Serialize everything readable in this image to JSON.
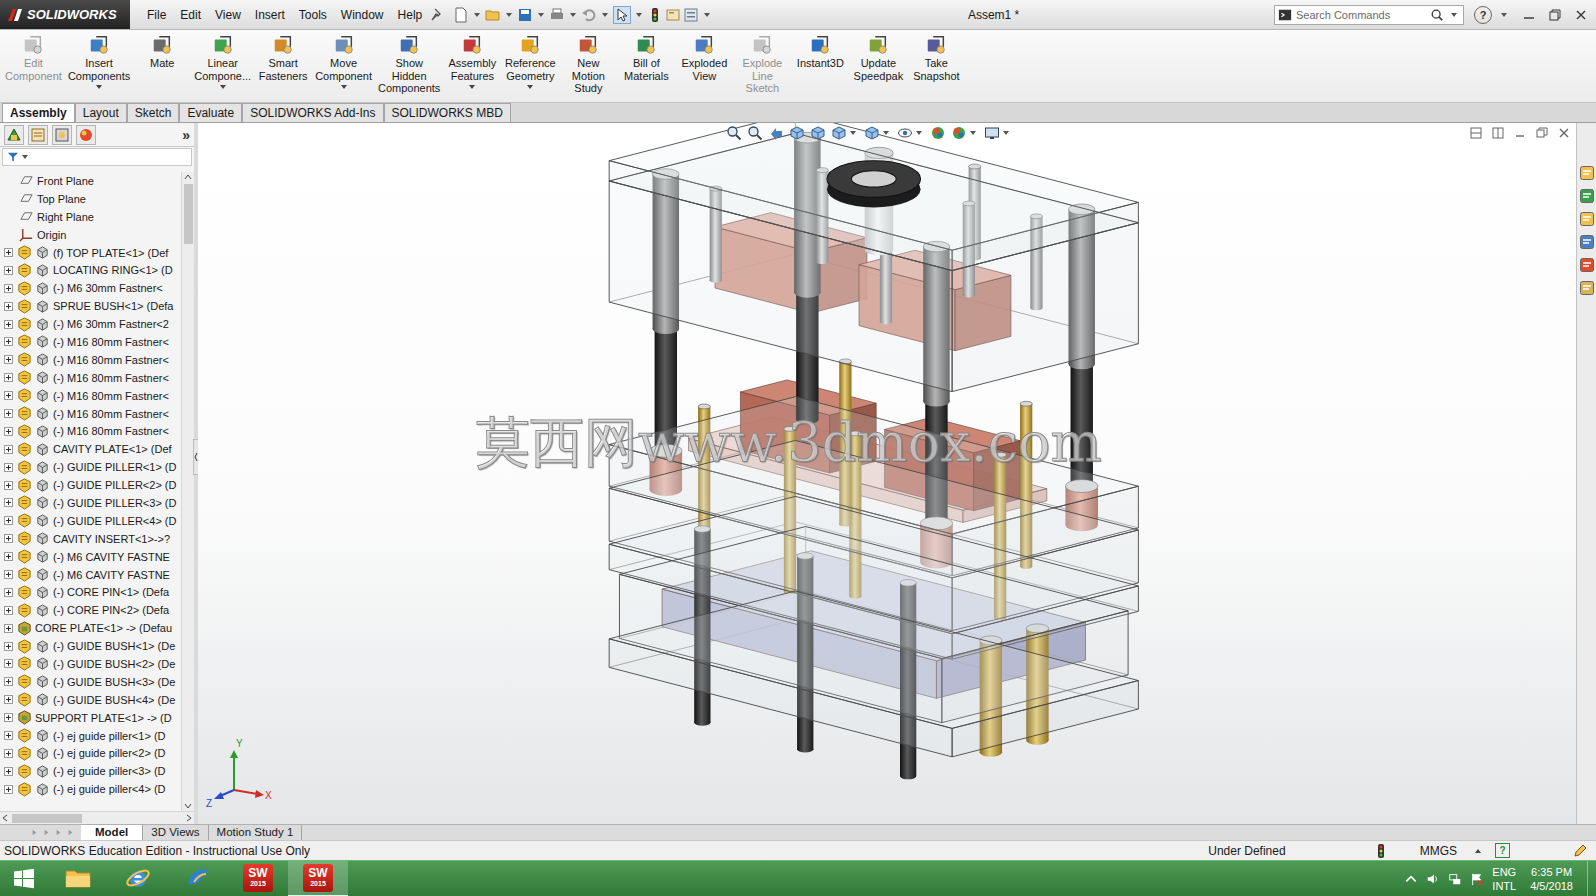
{
  "app": {
    "logo": "SOLIDWORKS",
    "title": "Assem1 *",
    "help": "?"
  },
  "menu": [
    "File",
    "Edit",
    "View",
    "Insert",
    "Tools",
    "Window",
    "Help"
  ],
  "search": {
    "placeholder": "Search Commands"
  },
  "ribbon": [
    {
      "lines": [
        "Edit",
        "Component"
      ],
      "dropdown": false,
      "disabled": true
    },
    {
      "lines": [
        "Insert",
        "Components"
      ],
      "dropdown": true,
      "disabled": false
    },
    {
      "lines": [
        "Mate"
      ],
      "dropdown": false,
      "disabled": false
    },
    {
      "lines": [
        "Linear",
        "Compone..."
      ],
      "dropdown": true,
      "disabled": false
    },
    {
      "lines": [
        "Smart",
        "Fasteners"
      ],
      "dropdown": false,
      "disabled": false
    },
    {
      "lines": [
        "Move",
        "Component"
      ],
      "dropdown": true,
      "disabled": false
    },
    {
      "lines": [
        "Show",
        "Hidden",
        "Components"
      ],
      "dropdown": false,
      "disabled": false
    },
    {
      "lines": [
        "Assembly",
        "Features"
      ],
      "dropdown": true,
      "disabled": false
    },
    {
      "lines": [
        "Reference",
        "Geometry"
      ],
      "dropdown": true,
      "disabled": false
    },
    {
      "lines": [
        "New",
        "Motion",
        "Study"
      ],
      "dropdown": false,
      "disabled": false
    },
    {
      "lines": [
        "Bill of",
        "Materials"
      ],
      "dropdown": false,
      "disabled": false
    },
    {
      "lines": [
        "Exploded",
        "View"
      ],
      "dropdown": false,
      "disabled": false
    },
    {
      "lines": [
        "Explode",
        "Line",
        "Sketch"
      ],
      "dropdown": false,
      "disabled": true
    },
    {
      "lines": [
        "Instant3D"
      ],
      "dropdown": false,
      "disabled": false
    },
    {
      "lines": [
        "Update",
        "Speedpak"
      ],
      "dropdown": false,
      "disabled": false
    },
    {
      "lines": [
        "Take",
        "Snapshot"
      ],
      "dropdown": false,
      "disabled": false
    }
  ],
  "tabs": [
    {
      "label": "Assembly",
      "selected": true
    },
    {
      "label": "Layout",
      "selected": false
    },
    {
      "label": "Sketch",
      "selected": false
    },
    {
      "label": "Evaluate",
      "selected": false
    },
    {
      "label": "SOLIDWORKS Add-Ins",
      "selected": false
    },
    {
      "label": "SOLIDWORKS MBD",
      "selected": false
    }
  ],
  "feature_manager": {
    "collapse": "»"
  },
  "tree": [
    {
      "label": "Front Plane",
      "kind": "plane",
      "expanded": false
    },
    {
      "label": "Top Plane",
      "kind": "plane",
      "expanded": false
    },
    {
      "label": "Right Plane",
      "kind": "plane",
      "expanded": false
    },
    {
      "label": "Origin",
      "kind": "origin",
      "expanded": false
    },
    {
      "label": "(f) TOP PLATE<1> (Def",
      "kind": "part",
      "expanded": false
    },
    {
      "label": "LOCATING RING<1> (D",
      "kind": "part",
      "expanded": false
    },
    {
      "label": "(-) M6 30mm Fastner<",
      "kind": "part",
      "expanded": false
    },
    {
      "label": "SPRUE BUSH<1> (Defa",
      "kind": "part",
      "expanded": false
    },
    {
      "label": "(-) M6 30mm Fastner<2",
      "kind": "part",
      "expanded": false
    },
    {
      "label": "(-) M16 80mm Fastner<",
      "kind": "part",
      "expanded": false
    },
    {
      "label": "(-) M16 80mm Fastner<",
      "kind": "part",
      "expanded": false
    },
    {
      "label": "(-) M16 80mm Fastner<",
      "kind": "part",
      "expanded": false
    },
    {
      "label": "(-) M16 80mm Fastner<",
      "kind": "part",
      "expanded": false
    },
    {
      "label": "(-) M16 80mm Fastner<",
      "kind": "part",
      "expanded": false
    },
    {
      "label": "(-) M16 80mm Fastner<",
      "kind": "part",
      "expanded": false
    },
    {
      "label": "CAVITY PLATE<1> (Def",
      "kind": "part",
      "expanded": false
    },
    {
      "label": "(-) GUIDE PILLER<1> (D",
      "kind": "part",
      "expanded": false
    },
    {
      "label": "(-) GUIDE PILLER<2> (D",
      "kind": "part",
      "expanded": false
    },
    {
      "label": "(-) GUIDE PILLER<3> (D",
      "kind": "part",
      "expanded": false
    },
    {
      "label": "(-) GUIDE PILLER<4> (D",
      "kind": "part",
      "expanded": false
    },
    {
      "label": "CAVITY INSERT<1>->?",
      "kind": "part",
      "expanded": false
    },
    {
      "label": "(-) M6 CAVITY FASTNE",
      "kind": "part",
      "expanded": false
    },
    {
      "label": "(-) M6 CAVITY FASTNE",
      "kind": "part",
      "expanded": false
    },
    {
      "label": "(-) CORE PIN<1> (Defa",
      "kind": "part",
      "expanded": false
    },
    {
      "label": "(-) CORE PIN<2> (Defa",
      "kind": "part",
      "expanded": false
    },
    {
      "label": "CORE PLATE<1> -> (Defau",
      "kind": "assembly",
      "expanded": false
    },
    {
      "label": "(-) GUIDE BUSH<1> (De",
      "kind": "part",
      "expanded": false
    },
    {
      "label": "(-) GUIDE BUSH<2> (De",
      "kind": "part",
      "expanded": false
    },
    {
      "label": "(-) GUIDE BUSH<3> (De",
      "kind": "part",
      "expanded": false
    },
    {
      "label": "(-) GUIDE BUSH<4> (De",
      "kind": "part",
      "expanded": false
    },
    {
      "label": "SUPPORT PLATE<1> -> (D",
      "kind": "assembly",
      "expanded": false
    },
    {
      "label": "(-) ej guide piller<1> (D",
      "kind": "part",
      "expanded": false
    },
    {
      "label": "(-) ej guide piller<2> (D",
      "kind": "part",
      "expanded": false
    },
    {
      "label": "(-) ej guide piller<3> (D",
      "kind": "part",
      "expanded": false
    },
    {
      "label": "(-) ej guide piller<4> (D",
      "kind": "part",
      "expanded": false
    }
  ],
  "viewport": {
    "watermark": "莫西网www.3dmox.com",
    "triad": {
      "y": "Y",
      "x": "X",
      "z": "Z"
    }
  },
  "bottom_tabs": [
    {
      "label": "Model",
      "selected": true
    },
    {
      "label": "3D Views",
      "selected": false
    },
    {
      "label": "Motion Study 1",
      "selected": false
    }
  ],
  "status_bar": {
    "edition": "SOLIDWORKS Education Edition - Instructional Use Only",
    "state": "Under Defined",
    "units": "MMGS",
    "help": "?"
  },
  "taskbar": {
    "apps": [
      {
        "kind": "explorer",
        "badge": "",
        "version": "",
        "active": false
      },
      {
        "kind": "ie",
        "badge": "",
        "version": "",
        "active": false
      },
      {
        "kind": "bird",
        "badge": "",
        "version": "",
        "active": false
      },
      {
        "kind": "solidworks",
        "badge": "SW",
        "version": "2015",
        "active": false
      },
      {
        "kind": "solidworks",
        "badge": "SW",
        "version": "2015",
        "active": true
      }
    ],
    "tray": {
      "language": "ENG",
      "layout": "INTL",
      "time": "6:35 PM",
      "date": "4/5/2018"
    }
  }
}
